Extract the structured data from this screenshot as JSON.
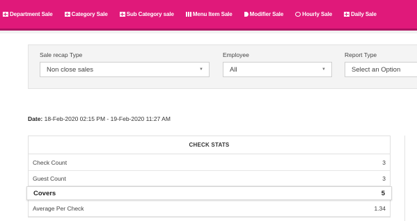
{
  "nav": {
    "tabs": [
      {
        "label": "Department Sale",
        "icon": "grid-icon"
      },
      {
        "label": "Category Sale",
        "icon": "grid-icon"
      },
      {
        "label": "Sub Category sale",
        "icon": "grid-icon"
      },
      {
        "label": "Menu Item Sale",
        "icon": "bars-icon"
      },
      {
        "label": "Modifier Sale",
        "icon": "d-icon"
      },
      {
        "label": "Hourly Sale",
        "icon": "clock-icon"
      },
      {
        "label": "Daily Sale",
        "icon": "grid-icon"
      }
    ],
    "color": "#e0197a"
  },
  "filters": {
    "recap_type": {
      "label": "Sale recap Type",
      "value": "Non close sales"
    },
    "employee": {
      "label": "Employee",
      "value": "All"
    },
    "report_type": {
      "label": "Report Type",
      "value": "Select an Option"
    }
  },
  "date": {
    "label": "Date:",
    "value": "18-Feb-2020 02:15 PM - 19-Feb-2020 11:27 AM"
  },
  "check_stats": {
    "title": "CHECK STATS",
    "rows": [
      {
        "label": "Check Count",
        "value": "3"
      },
      {
        "label": "Guest Count",
        "value": "3"
      },
      {
        "label": "Covers",
        "value": "5"
      },
      {
        "label": "Average Per Check",
        "value": "1.34"
      }
    ]
  }
}
